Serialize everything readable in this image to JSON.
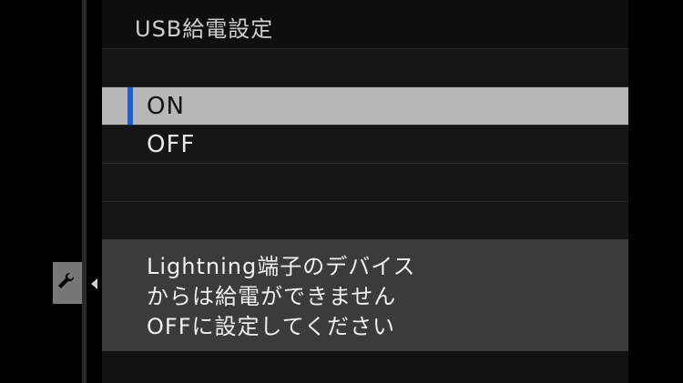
{
  "menu": {
    "title": "USB給電設定",
    "options": [
      {
        "label": "ON",
        "selected": true
      },
      {
        "label": "OFF",
        "selected": false
      }
    ]
  },
  "message": {
    "lines": [
      "Lightning端子のデバイス",
      "からは給電ができません",
      "OFFに設定してください"
    ]
  },
  "side_tab": {
    "icon": "wrench-icon"
  },
  "colors": {
    "accent": "#1f5fcf",
    "selected_row": "#b7b7b7",
    "message_bg": "#3b3b3b"
  }
}
